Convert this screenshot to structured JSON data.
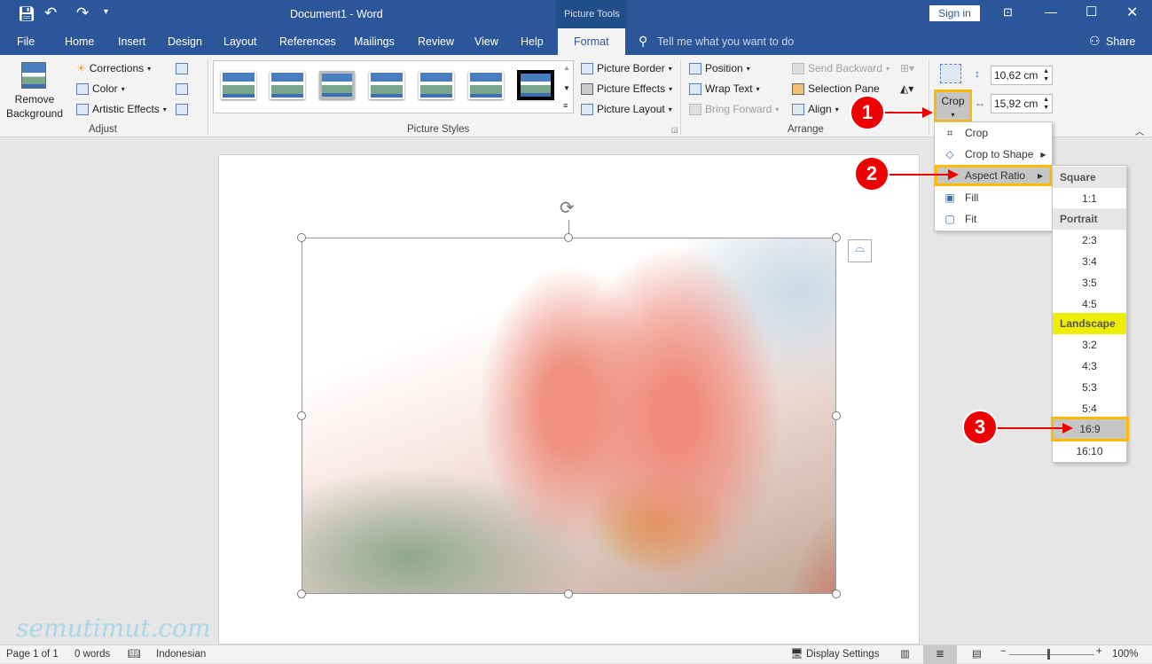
{
  "title_bar": {
    "document_title": "Document1  -  Word",
    "context_tab": "Picture Tools",
    "sign_in": "Sign in"
  },
  "tabs": [
    {
      "label": "File"
    },
    {
      "label": "Home"
    },
    {
      "label": "Insert"
    },
    {
      "label": "Design"
    },
    {
      "label": "Layout"
    },
    {
      "label": "References"
    },
    {
      "label": "Mailings"
    },
    {
      "label": "Review"
    },
    {
      "label": "View"
    },
    {
      "label": "Help"
    },
    {
      "label": "Format",
      "active": true
    }
  ],
  "tell_me": "Tell me what you want to do",
  "share": "Share",
  "ribbon": {
    "adjust": {
      "remove_background": "Remove Background",
      "corrections": "Corrections",
      "color": "Color",
      "artistic_effects": "Artistic Effects",
      "group": "Adjust"
    },
    "picture_styles": {
      "group": "Picture Styles",
      "border": "Picture Border",
      "effects": "Picture Effects",
      "layout": "Picture Layout"
    },
    "arrange": {
      "position": "Position",
      "wrap_text": "Wrap Text",
      "bring_forward": "Bring Forward",
      "send_backward": "Send Backward",
      "selection_pane": "Selection Pane",
      "align": "Align",
      "group": "Arrange"
    },
    "size": {
      "crop": "Crop",
      "height": "10,62 cm",
      "width": "15,92 cm"
    }
  },
  "crop_menu": {
    "items": [
      "Crop",
      "Crop to Shape",
      "Aspect Ratio",
      "Fill",
      "Fit"
    ]
  },
  "aspect_menu": {
    "square": "Square",
    "square_items": [
      "1:1"
    ],
    "portrait": "Portrait",
    "portrait_items": [
      "2:3",
      "3:4",
      "3:5",
      "4:5"
    ],
    "landscape": "Landscape",
    "landscape_items": [
      "3:2",
      "4:3",
      "5:3",
      "5:4",
      "16:9",
      "16:10"
    ],
    "selected": "16:9"
  },
  "annotations": [
    "1",
    "2",
    "3"
  ],
  "colors": {
    "accent": "#2b579a",
    "highlight": "#ffb900",
    "callout": "#e00000",
    "landscape_highlight": "#eeee00"
  },
  "watermark": "semutimut.com",
  "status": {
    "page": "Page 1 of 1",
    "words": "0 words",
    "language": "Indonesian",
    "display_settings": "Display Settings",
    "zoom": "100%"
  }
}
